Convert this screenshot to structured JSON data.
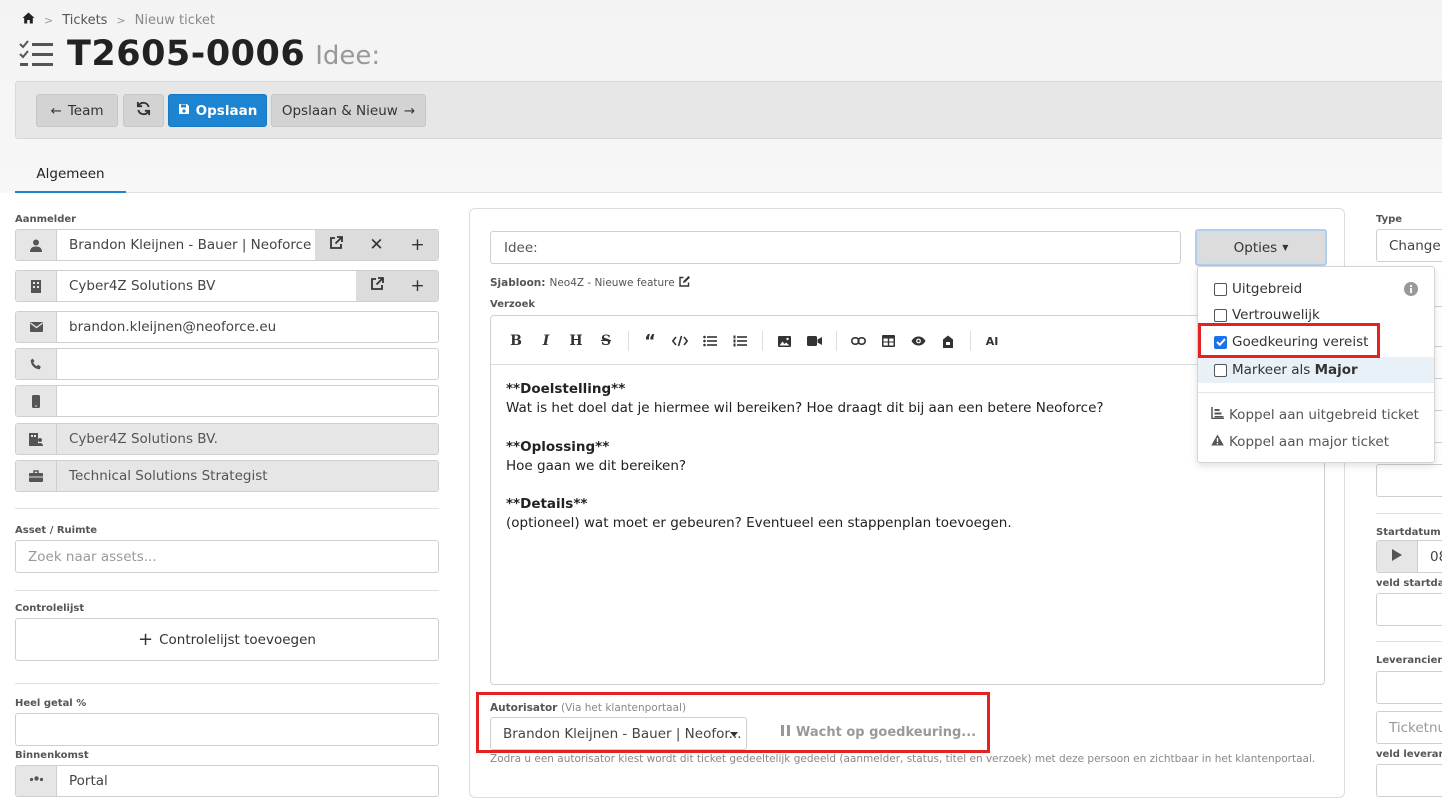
{
  "breadcrumb": {
    "home_icon": "home-icon",
    "items": [
      "Tickets",
      "Nieuw ticket"
    ]
  },
  "header": {
    "ticket_number": "T2605-0006",
    "ticket_title": "Idee:",
    "icon": "checklist-icon"
  },
  "toolbar": {
    "team_label": "Team",
    "refresh_icon": "refresh-icon",
    "save_label": "Opslaan",
    "save_new_label": "Opslaan & Nieuw"
  },
  "tabs": [
    {
      "label": "Algemeen",
      "active": true
    }
  ],
  "left": {
    "aanmelder_label": "Aanmelder",
    "aanmelder_name": "Brandon Kleijnen - Bauer | Neoforce",
    "company": "Cyber4Z Solutions BV",
    "email": "brandon.kleijnen@neoforce.eu",
    "phone": "",
    "mobile": "",
    "department": "Cyber4Z Solutions BV.",
    "job_title": "Technical Solutions Strategist",
    "asset_label": "Asset / Ruimte",
    "asset_placeholder": "Zoek naar assets...",
    "checklist_label": "Controlelijst",
    "checklist_button": "Controlelijst toevoegen",
    "heel_getal_label": "Heel getal %",
    "heel_getal_value": "",
    "binnenkomst_label": "Binnenkomst",
    "binnenkomst_value": "Portal"
  },
  "main": {
    "title_value": "Idee:",
    "opties_label": "Opties",
    "sjabloon_label": "Sjabloon:",
    "sjabloon_value": "Neo4Z - Nieuwe feature",
    "verzoek_label": "Verzoek",
    "editor_ai_label": "AI",
    "editor_lines": [
      "**Doelstelling**",
      "Wat is het doel dat je hiermee wil bereiken? Hoe draagt dit bij aan een betere Neoforce?",
      "**Oplossing**",
      "Hoe gaan we dit bereiken?",
      "**Details**",
      "(optioneel) wat moet er gebeuren? Eventueel een stappenplan toevoegen."
    ],
    "autorisator_label": "Autorisator",
    "autorisator_sub": "(Via het klantenportaal)",
    "autorisator_value": "Brandon Kleijnen - Bauer | Neofor...",
    "wacht_label": "Wacht op goedkeuring...",
    "autorisator_note": "Zodra u een autorisator kiest wordt dit ticket gedeeltelijk gedeeld (aanmelder, status, titel en verzoek) met deze persoon en zichtbaar in het klantenportaal."
  },
  "opties_menu": {
    "items": [
      {
        "label": "Uitgebreid",
        "checked": false
      },
      {
        "label": "Vertrouwelijk",
        "checked": false
      },
      {
        "label": "Goedkeuring vereist",
        "checked": true
      },
      {
        "label": "Markeer als ",
        "bold": "Major",
        "checked": false
      }
    ],
    "actions": [
      "Koppel aan uitgebreid ticket",
      "Koppel aan major ticket"
    ]
  },
  "right": {
    "type_label": "Type",
    "type_value": "Change",
    "startdatum_label": "Startdatum",
    "startdatum_value": "08",
    "veld_startdatum_label": "veld startdatum",
    "leverancier_label": "Leverancier",
    "ticketnummer_placeholder": "Ticketnummer",
    "veld_leverancier_label": "veld leverancier"
  },
  "colors": {
    "primary": "#1c84d1",
    "highlight": "#e52222"
  }
}
